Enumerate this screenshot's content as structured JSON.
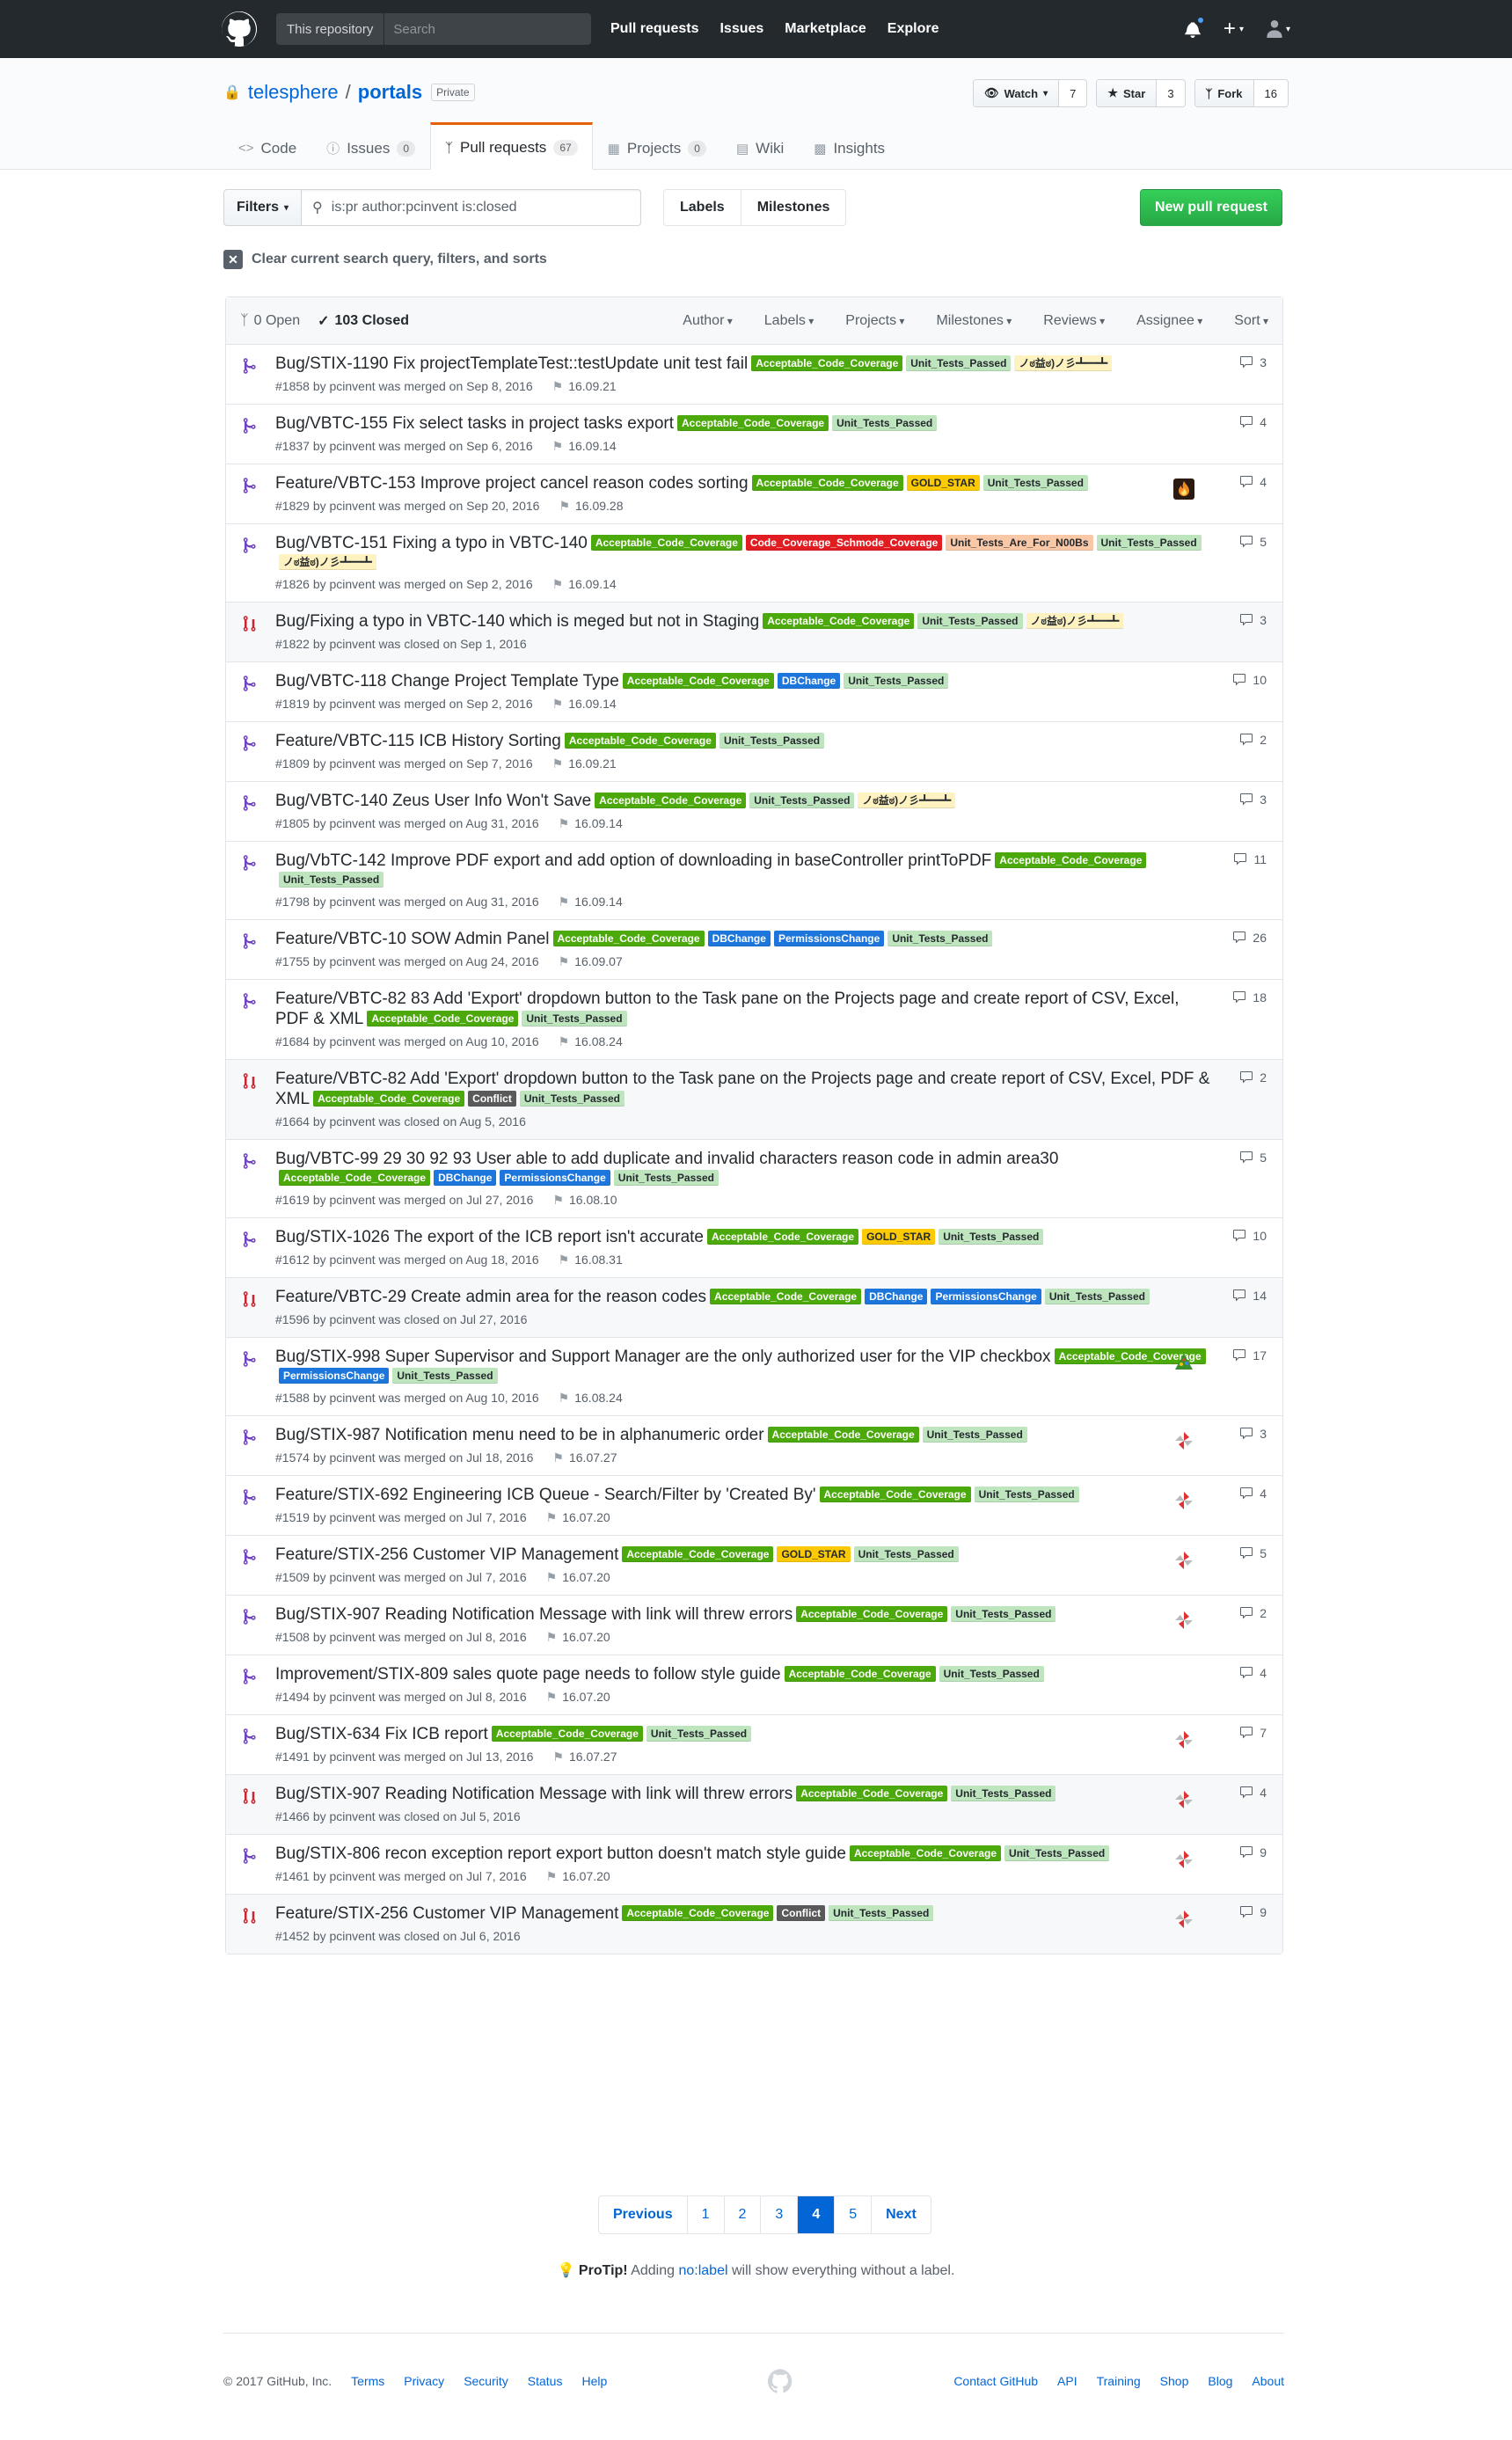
{
  "header": {
    "scope": "This repository",
    "search_placeholder": "Search",
    "nav": [
      "Pull requests",
      "Issues",
      "Marketplace",
      "Explore"
    ]
  },
  "repo": {
    "owner": "telesphere",
    "name": "portals",
    "visibility": "Private",
    "watch": {
      "label": "Watch",
      "count": "7"
    },
    "star": {
      "label": "Star",
      "count": "3"
    },
    "fork": {
      "label": "Fork",
      "count": "16"
    }
  },
  "tabs": [
    {
      "label": "Code",
      "count": ""
    },
    {
      "label": "Issues",
      "count": "0"
    },
    {
      "label": "Pull requests",
      "count": "67"
    },
    {
      "label": "Projects",
      "count": "0"
    },
    {
      "label": "Wiki",
      "count": ""
    },
    {
      "label": "Insights",
      "count": ""
    }
  ],
  "subnav": {
    "filters_label": "Filters",
    "query": "is:pr author:pcinvent is:closed",
    "labels": "Labels",
    "milestones": "Milestones",
    "new_pr": "New pull request"
  },
  "clear_text": "Clear current search query, filters, and sorts",
  "list_header": {
    "open": "0 Open",
    "closed": "103 Closed",
    "filters": [
      "Author",
      "Labels",
      "Projects",
      "Milestones",
      "Reviews",
      "Assignee",
      "Sort"
    ]
  },
  "label_colors": {
    "Acceptable_Code_Coverage": {
      "bg": "#4ca90c",
      "fg": "#ffffff"
    },
    "Unit_Tests_Passed": {
      "bg": "#bfe5bf",
      "fg": "#24292e"
    },
    "GOLD_STAR": {
      "bg": "#fbca04",
      "fg": "#24292e"
    },
    "Code_Coverage_Schmode_Coverage": {
      "bg": "#e11d21",
      "fg": "#ffffff"
    },
    "Unit_Tests_Are_For_N00Bs": {
      "bg": "#f9c8a6",
      "fg": "#24292e"
    },
    "DBChange": {
      "bg": "#1d76db",
      "fg": "#ffffff"
    },
    "PermissionsChange": {
      "bg": "#1d76db",
      "fg": "#ffffff"
    },
    "Conflict": {
      "bg": "#5a5a5a",
      "fg": "#ffffff"
    },
    "ノಠ益ಠ)ノ彡┻━┻": {
      "bg": "#fef2c0",
      "fg": "#24292e"
    }
  },
  "pulls": [
    {
      "title": "Bug/STIX-1190 Fix projectTemplateTest::testUpdate unit test fail",
      "labels": [
        "Acceptable_Code_Coverage",
        "Unit_Tests_Passed",
        "ノಠ益ಠ)ノ彡┻━┻"
      ],
      "meta": "#1858 by pcinvent was merged on Sep 8, 2016",
      "milestone": "16.09.21",
      "comments": "3",
      "state": "merged",
      "avatar": ""
    },
    {
      "title": "Bug/VBTC-155 Fix select tasks in project tasks export",
      "labels": [
        "Acceptable_Code_Coverage",
        "Unit_Tests_Passed"
      ],
      "meta": "#1837 by pcinvent was merged on Sep 6, 2016",
      "milestone": "16.09.14",
      "comments": "4",
      "state": "merged",
      "avatar": ""
    },
    {
      "title": "Feature/VBTC-153 Improve project cancel reason codes sorting",
      "labels": [
        "Acceptable_Code_Coverage",
        "GOLD_STAR",
        "Unit_Tests_Passed"
      ],
      "meta": "#1829 by pcinvent was merged on Sep 20, 2016",
      "milestone": "16.09.28",
      "comments": "4",
      "state": "merged",
      "avatar": "fire"
    },
    {
      "title": "Bug/VBTC-151 Fixing a typo in VBTC-140",
      "labels": [
        "Acceptable_Code_Coverage",
        "Code_Coverage_Schmode_Coverage",
        "Unit_Tests_Are_For_N00Bs",
        "Unit_Tests_Passed",
        "ノಠ益ಠ)ノ彡┻━┻"
      ],
      "meta": "#1826 by pcinvent was merged on Sep 2, 2016",
      "milestone": "16.09.14",
      "comments": "5",
      "state": "merged",
      "avatar": ""
    },
    {
      "title": "Bug/Fixing a typo in VBTC-140 which is meged but not in Staging",
      "labels": [
        "Acceptable_Code_Coverage",
        "Unit_Tests_Passed",
        "ノಠ益ಠ)ノ彡┻━┻"
      ],
      "meta": "#1822 by pcinvent was closed on Sep 1, 2016",
      "milestone": "",
      "comments": "3",
      "state": "closed",
      "avatar": ""
    },
    {
      "title": "Bug/VBTC-118 Change Project Template Type",
      "labels": [
        "Acceptable_Code_Coverage",
        "DBChange",
        "Unit_Tests_Passed"
      ],
      "meta": "#1819 by pcinvent was merged on Sep 2, 2016",
      "milestone": "16.09.14",
      "comments": "10",
      "state": "merged",
      "avatar": ""
    },
    {
      "title": "Feature/VBTC-115 ICB History Sorting",
      "labels": [
        "Acceptable_Code_Coverage",
        "Unit_Tests_Passed"
      ],
      "meta": "#1809 by pcinvent was merged on Sep 7, 2016",
      "milestone": "16.09.21",
      "comments": "2",
      "state": "merged",
      "avatar": ""
    },
    {
      "title": "Bug/VBTC-140 Zeus User Info Won't Save",
      "labels": [
        "Acceptable_Code_Coverage",
        "Unit_Tests_Passed",
        "ノಠ益ಠ)ノ彡┻━┻"
      ],
      "meta": "#1805 by pcinvent was merged on Aug 31, 2016",
      "milestone": "16.09.14",
      "comments": "3",
      "state": "merged",
      "avatar": ""
    },
    {
      "title": "Bug/VbTC-142 Improve PDF export and add option of downloading in baseController printToPDF",
      "labels": [
        "Acceptable_Code_Coverage",
        "Unit_Tests_Passed"
      ],
      "meta": "#1798 by pcinvent was merged on Aug 31, 2016",
      "milestone": "16.09.14",
      "comments": "11",
      "state": "merged",
      "avatar": ""
    },
    {
      "title": "Feature/VBTC-10 SOW Admin Panel",
      "labels": [
        "Acceptable_Code_Coverage",
        "DBChange",
        "PermissionsChange",
        "Unit_Tests_Passed"
      ],
      "meta": "#1755 by pcinvent was merged on Aug 24, 2016",
      "milestone": "16.09.07",
      "comments": "26",
      "state": "merged",
      "avatar": ""
    },
    {
      "title": "Feature/VBTC-82 83 Add 'Export' dropdown button to the Task pane on the Projects page and create report of CSV, Excel, PDF & XML",
      "labels": [
        "Acceptable_Code_Coverage",
        "Unit_Tests_Passed"
      ],
      "meta": "#1684 by pcinvent was merged on Aug 10, 2016",
      "milestone": "16.08.24",
      "comments": "18",
      "state": "merged",
      "avatar": ""
    },
    {
      "title": "Feature/VBTC-82 Add 'Export' dropdown button to the Task pane on the Projects page and create report of CSV, Excel, PDF & XML",
      "labels": [
        "Acceptable_Code_Coverage",
        "Conflict",
        "Unit_Tests_Passed"
      ],
      "meta": "#1664 by pcinvent was closed on Aug 5, 2016",
      "milestone": "",
      "comments": "2",
      "state": "closed",
      "avatar": ""
    },
    {
      "title": "Bug/VBTC-99 29 30 92 93 User able to add duplicate and invalid characters reason code in admin area30",
      "labels": [
        "Acceptable_Code_Coverage",
        "DBChange",
        "PermissionsChange",
        "Unit_Tests_Passed"
      ],
      "meta": "#1619 by pcinvent was merged on Jul 27, 2016",
      "milestone": "16.08.10",
      "comments": "5",
      "state": "merged",
      "avatar": ""
    },
    {
      "title": "Bug/STIX-1026 The export of the ICB report isn't accurate",
      "labels": [
        "Acceptable_Code_Coverage",
        "GOLD_STAR",
        "Unit_Tests_Passed"
      ],
      "meta": "#1612 by pcinvent was merged on Aug 18, 2016",
      "milestone": "16.08.31",
      "comments": "10",
      "state": "merged",
      "avatar": ""
    },
    {
      "title": "Feature/VBTC-29 Create admin area for the reason codes",
      "labels": [
        "Acceptable_Code_Coverage",
        "DBChange",
        "PermissionsChange",
        "Unit_Tests_Passed"
      ],
      "meta": "#1596 by pcinvent was closed on Jul 27, 2016",
      "milestone": "",
      "comments": "14",
      "state": "closed",
      "avatar": ""
    },
    {
      "title": "Bug/STIX-998 Super Supervisor and Support Manager are the only authorized user for the VIP checkbox",
      "labels": [
        "Acceptable_Code_Coverage",
        "PermissionsChange",
        "Unit_Tests_Passed"
      ],
      "meta": "#1588 by pcinvent was merged on Aug 10, 2016",
      "milestone": "16.08.24",
      "comments": "17",
      "state": "merged",
      "avatar": "tree"
    },
    {
      "title": "Bug/STIX-987 Notification menu need to be in alphanumeric order",
      "labels": [
        "Acceptable_Code_Coverage",
        "Unit_Tests_Passed"
      ],
      "meta": "#1574 by pcinvent was merged on Jul 18, 2016",
      "milestone": "16.07.27",
      "comments": "3",
      "state": "merged",
      "avatar": "pinwheel"
    },
    {
      "title": "Feature/STIX-692 Engineering ICB Queue - Search/Filter by 'Created By'",
      "labels": [
        "Acceptable_Code_Coverage",
        "Unit_Tests_Passed"
      ],
      "meta": "#1519 by pcinvent was merged on Jul 7, 2016",
      "milestone": "16.07.20",
      "comments": "4",
      "state": "merged",
      "avatar": "pinwheel"
    },
    {
      "title": "Feature/STIX-256 Customer VIP Management",
      "labels": [
        "Acceptable_Code_Coverage",
        "GOLD_STAR",
        "Unit_Tests_Passed"
      ],
      "meta": "#1509 by pcinvent was merged on Jul 7, 2016",
      "milestone": "16.07.20",
      "comments": "5",
      "state": "merged",
      "avatar": "pinwheel"
    },
    {
      "title": "Bug/STIX-907 Reading Notification Message with link will threw errors",
      "labels": [
        "Acceptable_Code_Coverage",
        "Unit_Tests_Passed"
      ],
      "meta": "#1508 by pcinvent was merged on Jul 8, 2016",
      "milestone": "16.07.20",
      "comments": "2",
      "state": "merged",
      "avatar": "pinwheel"
    },
    {
      "title": "Improvement/STIX-809 sales quote page needs to follow style guide",
      "labels": [
        "Acceptable_Code_Coverage",
        "Unit_Tests_Passed"
      ],
      "meta": "#1494 by pcinvent was merged on Jul 8, 2016",
      "milestone": "16.07.20",
      "comments": "4",
      "state": "merged",
      "avatar": ""
    },
    {
      "title": "Bug/STIX-634 Fix ICB report",
      "labels": [
        "Acceptable_Code_Coverage",
        "Unit_Tests_Passed"
      ],
      "meta": "#1491 by pcinvent was merged on Jul 13, 2016",
      "milestone": "16.07.27",
      "comments": "7",
      "state": "merged",
      "avatar": "pinwheel"
    },
    {
      "title": "Bug/STIX-907 Reading Notification Message with link will threw errors",
      "labels": [
        "Acceptable_Code_Coverage",
        "Unit_Tests_Passed"
      ],
      "meta": "#1466 by pcinvent was closed on Jul 5, 2016",
      "milestone": "",
      "comments": "4",
      "state": "closed",
      "avatar": "pinwheel"
    },
    {
      "title": "Bug/STIX-806 recon exception report export button doesn't match style guide",
      "labels": [
        "Acceptable_Code_Coverage",
        "Unit_Tests_Passed"
      ],
      "meta": "#1461 by pcinvent was merged on Jul 7, 2016",
      "milestone": "16.07.20",
      "comments": "9",
      "state": "merged",
      "avatar": "pinwheel"
    },
    {
      "title": "Feature/STIX-256 Customer VIP Management",
      "labels": [
        "Acceptable_Code_Coverage",
        "Conflict",
        "Unit_Tests_Passed"
      ],
      "meta": "#1452 by pcinvent was closed on Jul 6, 2016",
      "milestone": "",
      "comments": "9",
      "state": "closed",
      "avatar": "pinwheel"
    }
  ],
  "pagination": {
    "previous": "Previous",
    "pages": [
      "1",
      "2",
      "3",
      "4",
      "5"
    ],
    "current": "4",
    "next": "Next"
  },
  "protip": {
    "lead": "ProTip!",
    "pre": "Adding",
    "link": "no:label",
    "post": "will show everything without a label."
  },
  "footer": {
    "copyright": "© 2017 GitHub, Inc.",
    "left": [
      "Terms",
      "Privacy",
      "Security",
      "Status",
      "Help"
    ],
    "right": [
      "Contact GitHub",
      "API",
      "Training",
      "Shop",
      "Blog",
      "About"
    ]
  },
  "colors": {
    "merged": "#6f42c1",
    "closed": "#cb2431",
    "accent_tab": "#e36209",
    "link": "#0366d6"
  }
}
